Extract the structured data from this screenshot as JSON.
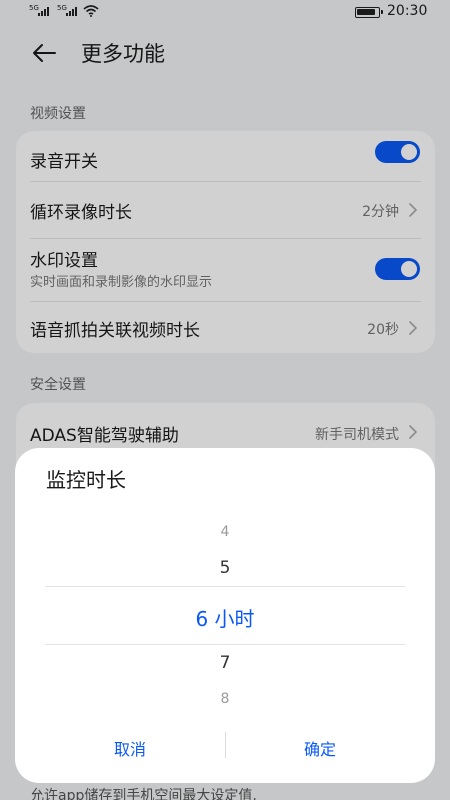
{
  "status_bar": {
    "sim1": "5G",
    "sim2": "5G",
    "time": "20:30"
  },
  "header": {
    "title": "更多功能"
  },
  "video_settings": {
    "section_title": "视频设置",
    "items": [
      {
        "label": "录音开关",
        "toggle": true
      },
      {
        "label": "循环录像时长",
        "value": "2分钟"
      },
      {
        "label": "水印设置",
        "sub": "实时画面和录制影像的水印显示",
        "toggle": true
      },
      {
        "label": "语音抓拍关联视频时长",
        "value": "20秒"
      }
    ]
  },
  "safety_settings": {
    "section_title": "安全设置",
    "items": [
      {
        "label": "ADAS智能驾驶辅助",
        "value": "新手司机模式"
      }
    ]
  },
  "background_bottom_text": "允许app储存到手机空间最大设定值,",
  "dialog": {
    "title": "监控时长",
    "picker": {
      "above_far": "4",
      "above_near": "5",
      "selected": "6 小时",
      "below_near": "7",
      "below_far": "8"
    },
    "cancel_label": "取消",
    "confirm_label": "确定"
  },
  "colors": {
    "accent": "#0a59f7",
    "background": "#f1f3f5",
    "card": "#ffffff"
  }
}
